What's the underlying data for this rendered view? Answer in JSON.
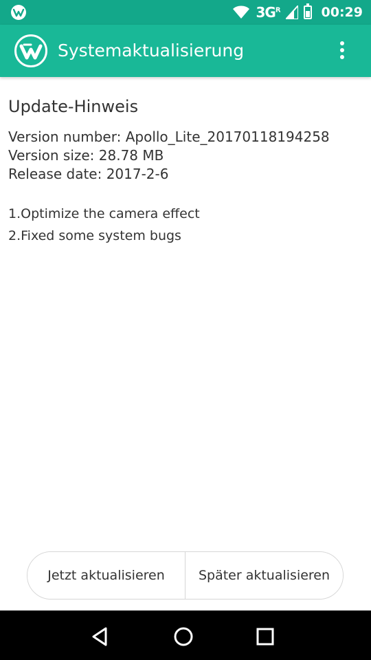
{
  "status_bar": {
    "network": "3G",
    "network_sup": "R",
    "time": "00:29"
  },
  "app_bar": {
    "title": "Systemaktualisierung",
    "logo_icon": "app-logo-icon",
    "menu_icon": "overflow-menu-icon"
  },
  "content": {
    "headline": "Update-Hinweis",
    "version_number": "Version number: Apollo_Lite_20170118194258",
    "version_size": "Version size: 28.78 MB",
    "release_date": "Release date: 2017-2-6",
    "notes": [
      "1.Optimize the camera effect",
      "2.Fixed some system bugs"
    ]
  },
  "buttons": {
    "update_now": "Jetzt aktualisieren",
    "update_later": "Später aktualisieren"
  },
  "nav_bar": {
    "back_icon": "back-icon",
    "home_icon": "home-icon",
    "recents_icon": "recents-icon"
  },
  "colors": {
    "status_bar": "#13a88a",
    "app_bar": "#19b897",
    "text": "#333333"
  }
}
